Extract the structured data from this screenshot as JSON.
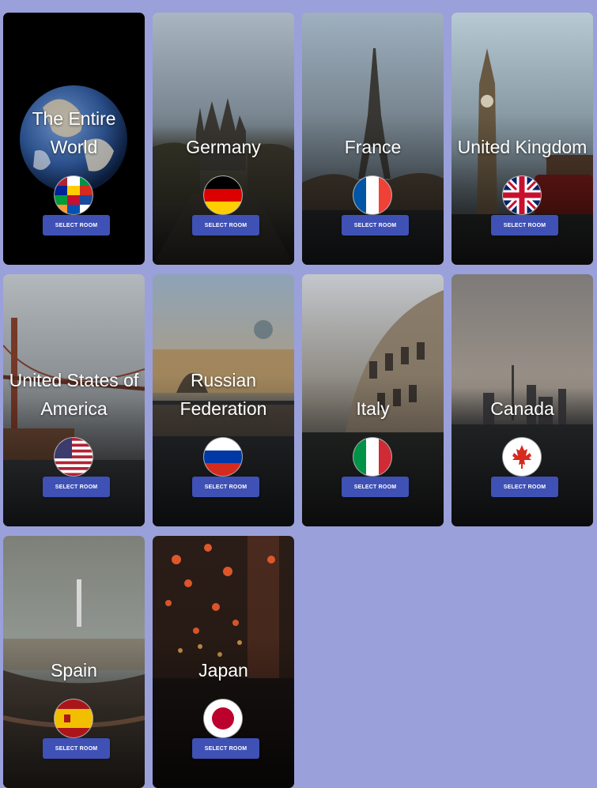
{
  "cards": [
    {
      "title": "The Entire World",
      "flag_icon": "world-flags-icon",
      "button": "SELECT ROOM"
    },
    {
      "title": "Germany",
      "flag_icon": "germany-flag-icon",
      "button": "SELECT ROOM"
    },
    {
      "title": "France",
      "flag_icon": "france-flag-icon",
      "button": "SELECT ROOM"
    },
    {
      "title": "United Kingdom",
      "flag_icon": "uk-flag-icon",
      "button": "SELECT ROOM"
    },
    {
      "title": "United States of America",
      "flag_icon": "usa-flag-icon",
      "button": "SELECT ROOM"
    },
    {
      "title": "Russian Federation",
      "flag_icon": "russia-flag-icon",
      "button": "SELECT ROOM"
    },
    {
      "title": "Italy",
      "flag_icon": "italy-flag-icon",
      "button": "SELECT ROOM"
    },
    {
      "title": "Canada",
      "flag_icon": "canada-flag-icon",
      "button": "SELECT ROOM"
    },
    {
      "title": "Spain",
      "flag_icon": "spain-flag-icon",
      "button": "SELECT ROOM"
    },
    {
      "title": "Japan",
      "flag_icon": "japan-flag-icon",
      "button": "SELECT ROOM"
    }
  ],
  "colors": {
    "page_background": "#9aa0d9",
    "button": "#3f51b5",
    "button_text": "#ffffff",
    "title_text": "#ffffff"
  }
}
